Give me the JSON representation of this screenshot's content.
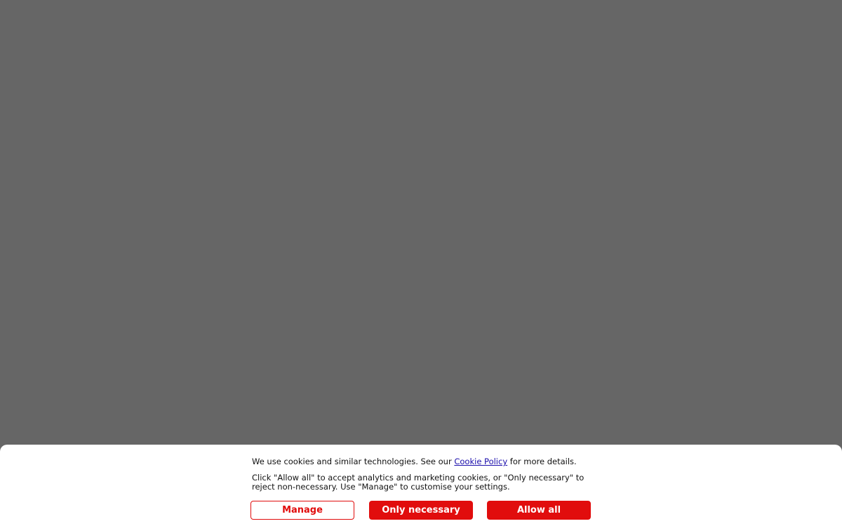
{
  "cookie_banner": {
    "line1_prefix": "We use cookies and similar technologies. See our ",
    "policy_link_text": "Cookie Policy",
    "line1_suffix": " for more details.",
    "line2": "Click \"Allow all\" to accept analytics and marketing cookies, or \"Only necessary\" to reject non-necessary. Use \"Manage\" to customise your settings.",
    "buttons": {
      "manage": "Manage",
      "only_necessary": "Only necessary",
      "allow_all": "Allow all"
    }
  },
  "colors": {
    "overlay": "#666666",
    "accent": "#e10d0d",
    "link": "#1a0dab"
  }
}
